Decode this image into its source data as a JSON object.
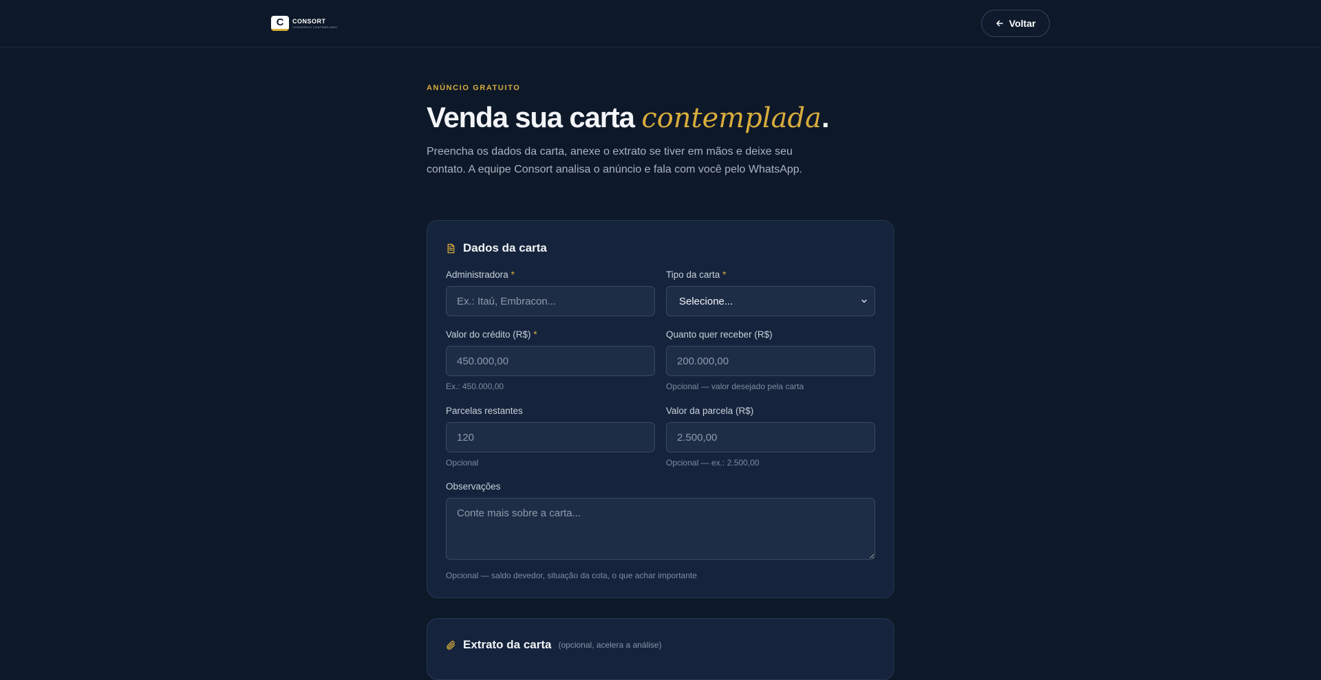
{
  "header": {
    "logo_mark": "C",
    "logo_name": "CONSORT",
    "logo_tagline": "CONSÓRCIO CONTEMPLADO",
    "back_label": "Voltar"
  },
  "hero": {
    "eyebrow": "ANÚNCIO GRATUITO",
    "title_main": "Venda sua carta ",
    "title_accent": "contemplada",
    "title_end": ".",
    "description": "Preencha os dados da carta, anexe o extrato se tiver em mãos e deixe seu contato. A equipe Consort analisa o anúncio e fala com você pelo WhatsApp."
  },
  "card_data": {
    "title": "Dados da carta",
    "required_mark": "*",
    "administradora": {
      "label": "Administradora",
      "placeholder": "Ex.: Itaú, Embracon..."
    },
    "tipo": {
      "label": "Tipo da carta",
      "selected": "Selecione..."
    },
    "valor_credito": {
      "label": "Valor do crédito (R$)",
      "placeholder": "450.000,00",
      "hint": "Ex.: 450.000,00"
    },
    "quanto_receber": {
      "label": "Quanto quer receber (R$)",
      "placeholder": "200.000,00",
      "hint": "Opcional — valor desejado pela carta"
    },
    "parcelas_restantes": {
      "label": "Parcelas restantes",
      "placeholder": "120",
      "hint": "Opcional"
    },
    "valor_parcela": {
      "label": "Valor da parcela (R$)",
      "placeholder": "2.500,00",
      "hint": "Opcional — ex.: 2.500,00"
    },
    "observacoes": {
      "label": "Observações",
      "placeholder": "Conte mais sobre a carta...",
      "hint": "Opcional — saldo devedor, situação da cota, o que achar importante"
    }
  },
  "card_extrato": {
    "title": "Extrato da carta",
    "subtitle": "(opcional, acelera a análise)"
  },
  "colors": {
    "background": "#0d1829",
    "card": "#15243c",
    "accent": "#d9ad3c",
    "input": "#1d2d46"
  }
}
